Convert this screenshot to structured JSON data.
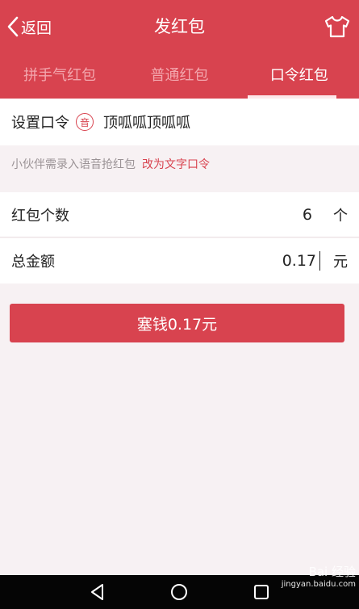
{
  "header": {
    "back_label": "返回",
    "title": "发红包"
  },
  "tabs": [
    {
      "label": "拼手气红包",
      "active": false
    },
    {
      "label": "普通红包",
      "active": false
    },
    {
      "label": "口令红包",
      "active": true
    }
  ],
  "password": {
    "label": "设置口令",
    "voice_badge": "音",
    "value": "顶呱呱顶呱呱"
  },
  "hint": {
    "text": "小伙伴需录入语音抢红包",
    "link": "改为文字口令"
  },
  "count": {
    "label": "红包个数",
    "value": "6",
    "unit": "个"
  },
  "amount": {
    "label": "总金额",
    "value": "0.17",
    "unit": "元"
  },
  "submit_label": "塞钱0.17元",
  "watermark": {
    "line1": "Bai 经验",
    "line2": "jingyan.baidu.com"
  },
  "colors": {
    "accent": "#d8434f",
    "background": "#f7f1f3"
  }
}
